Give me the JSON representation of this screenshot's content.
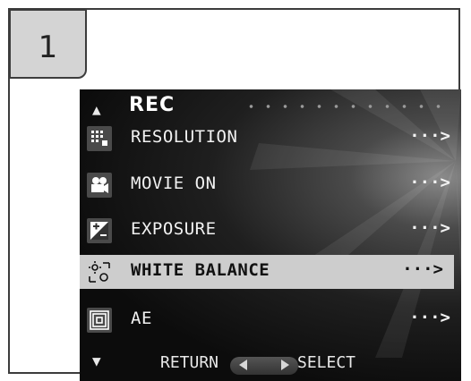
{
  "step": {
    "number": "1"
  },
  "menu": {
    "title": "REC",
    "items": [
      {
        "label": "RESOLUTION",
        "icon": "resolution-icon",
        "more": "···>"
      },
      {
        "label": "MOVIE ON",
        "icon": "movie-camera-icon",
        "more": "···>"
      },
      {
        "label": "EXPOSURE",
        "icon": "exposure-icon",
        "more": "···>"
      },
      {
        "label": "WHITE BALANCE",
        "icon": "white-balance-icon",
        "more": "···>",
        "selected": true
      },
      {
        "label": "AE",
        "icon": "ae-metering-icon",
        "more": "···>"
      }
    ]
  },
  "footer": {
    "return_label": "RETURN",
    "select_label": "SELECT"
  },
  "colors": {
    "selected_row": "#cdcdcd",
    "screen_bg": "#0c0c0c",
    "text": "#f2f2f2"
  }
}
